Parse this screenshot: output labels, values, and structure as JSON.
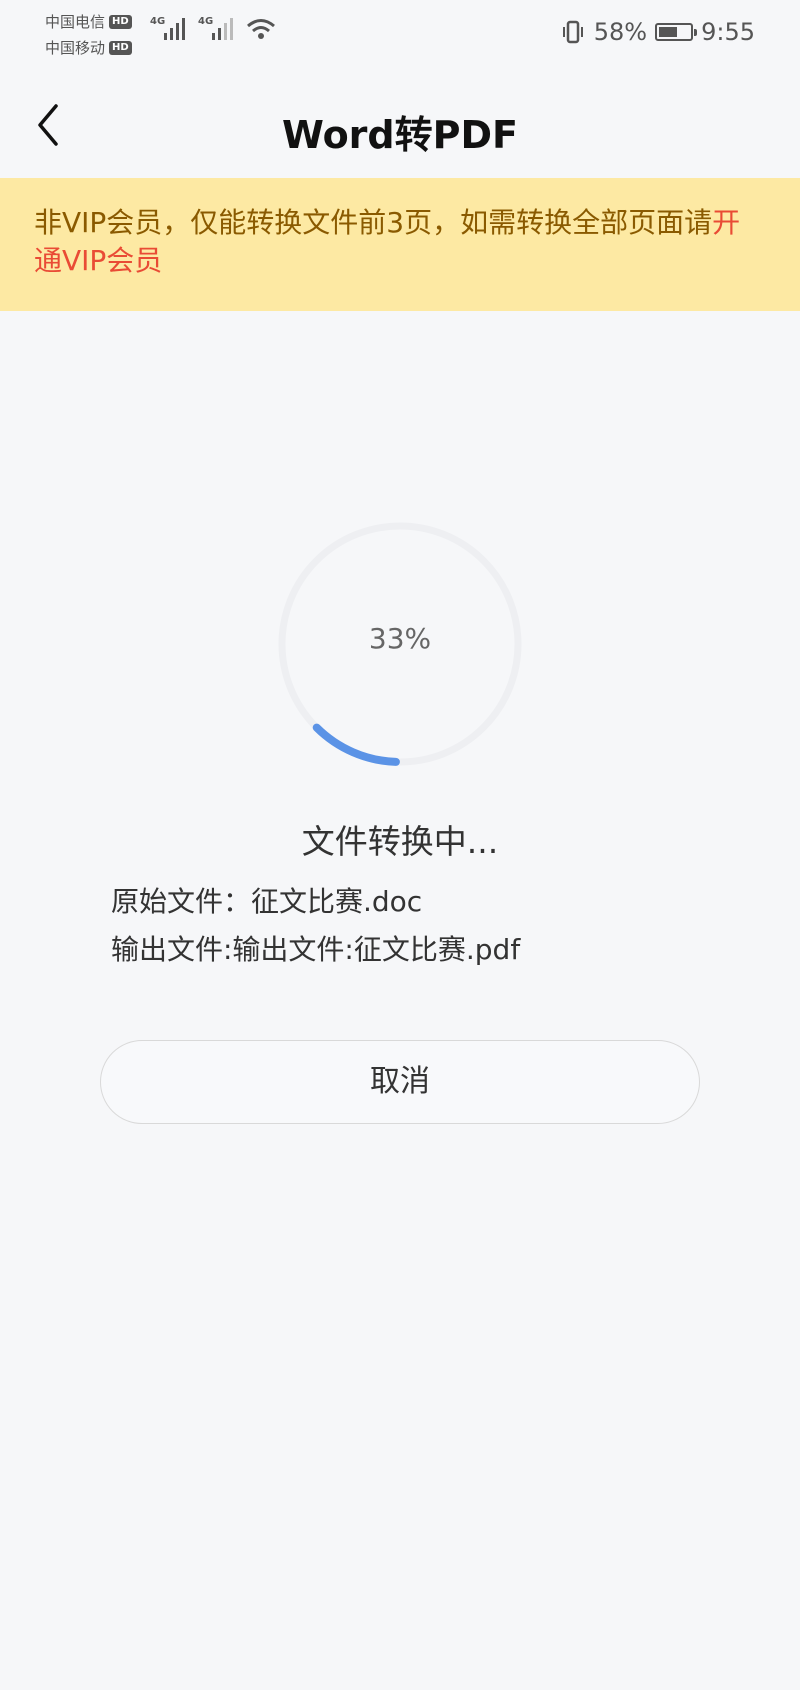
{
  "status_bar": {
    "carrier1": "中国电信",
    "carrier2": "中国移动",
    "hd": "HD",
    "net1": "4G",
    "net2": "4G",
    "battery_percent": "58%",
    "time": "9:55",
    "icons": [
      "signal-icon",
      "wifi-icon",
      "vibrate-icon",
      "battery-icon"
    ]
  },
  "nav": {
    "title": "Word转PDF",
    "back_icon": "chevron-left-icon"
  },
  "banner": {
    "text": "非VIP会员，仅能转换文件前3页，如需转换全部页面请",
    "link": "开通VIP会员"
  },
  "conversion": {
    "progress": 0.33,
    "progress_label": "33%",
    "status": "文件转换中...",
    "source_file": "原始文件：征文比赛.doc",
    "output_file": "输出文件:输出文件:征文比赛.pdf"
  },
  "actions": {
    "cancel_label": "取消"
  },
  "colors": {
    "banner_bg": "#fde9a3",
    "banner_text": "#8a5a00",
    "link": "#e94b35",
    "progress_arc": "#5b93e6",
    "progress_track": "#eeeff2"
  }
}
